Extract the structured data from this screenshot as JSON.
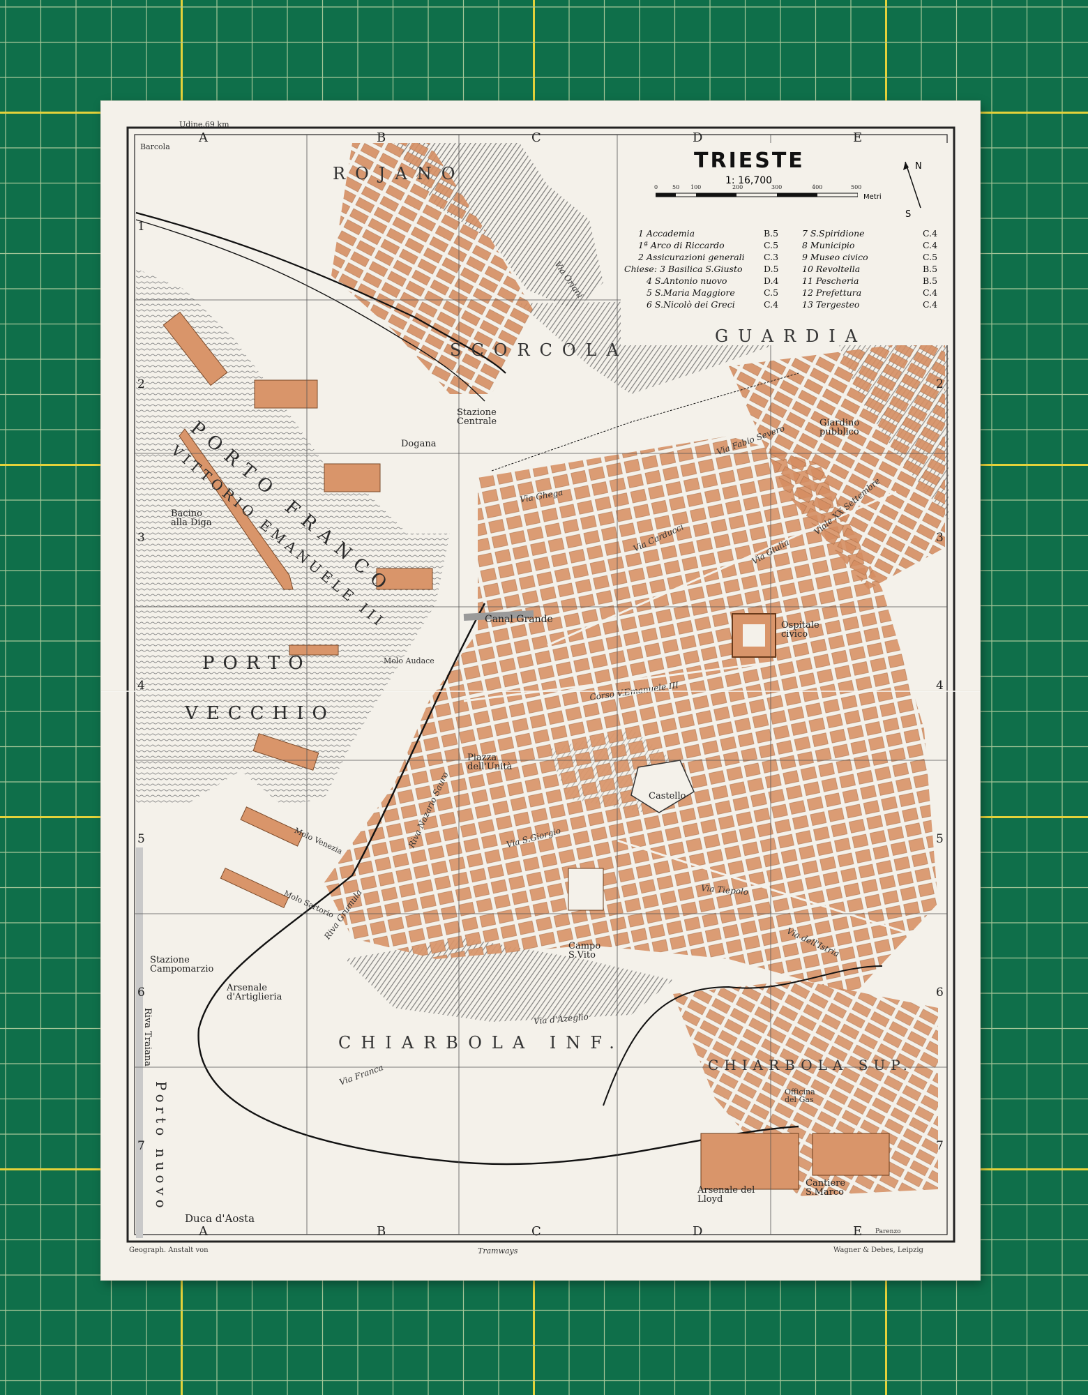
{
  "title": "TRIESTE",
  "scale": "1: 16,700",
  "scale_unit": "Metri",
  "scale_ticks": [
    "0",
    "50",
    "100",
    "200",
    "300",
    "400",
    "500"
  ],
  "compass": {
    "n": "N",
    "s": "S"
  },
  "columns": [
    "A",
    "B",
    "C",
    "D",
    "E"
  ],
  "rows": [
    "1",
    "2",
    "3",
    "4",
    "5",
    "6",
    "7"
  ],
  "legend": [
    {
      "label": "1 Accademia",
      "ref": "B.5"
    },
    {
      "label": "1ª Arco di Riccardo",
      "ref": "C.5"
    },
    {
      "label": "2 Assicurazioni generali",
      "ref": "C.3"
    },
    {
      "label": "Chiese: 3 Basilica S.Giusto",
      "ref": "D.5"
    },
    {
      "label": "4 S.Antonio nuovo",
      "ref": "D.4"
    },
    {
      "label": "5 S.Maria Maggiore",
      "ref": "C.5"
    },
    {
      "label": "6 S.Nicolò dei Greci",
      "ref": "C.4"
    },
    {
      "label": "7 S.Spiridione",
      "ref": "C.4"
    },
    {
      "label": "8 Municipio",
      "ref": "C.4"
    },
    {
      "label": "9 Museo civico",
      "ref": "C.5"
    },
    {
      "label": "10 Revoltella",
      "ref": "B.5"
    },
    {
      "label": "11 Pescheria",
      "ref": "B.5"
    },
    {
      "label": "12 Prefettura",
      "ref": "C.4"
    },
    {
      "label": "13 Tergesteo",
      "ref": "C.4"
    }
  ],
  "districts": [
    "ROJANO",
    "SCORCOLA",
    "GUARDIA",
    "CHIARBOLA INF.",
    "CHIARBOLA SUP."
  ],
  "harbor_labels": [
    "PORTO FRANCO",
    "VITTORIO EMANUELE III",
    "PORTO",
    "VECCHIO",
    "Porto nuovo"
  ],
  "places": {
    "stazione": "Stazione Centrale",
    "dogana": "Dogana",
    "diga": "Bacino alla Diga",
    "canal": "Canal Grande",
    "castello": "Castello",
    "ospitale": "Ospitale civico",
    "giardino": "Giardino pubblico",
    "campo": "Campo S.Vito",
    "arsenale_art": "Arsenale d'Artiglieria",
    "arsenale_lloyd": "Arsenale del Lloyd",
    "cantiere": "Cantiere S.Marco",
    "stazione_camp": "Stazione Campomarzio",
    "duca": "Duca d'Aosta",
    "riva": "Riva Traiana",
    "piazza": "Piazza dell'Unità",
    "molo_sartorio": "Molo Sartorio",
    "molo_venezia": "Molo Venezia",
    "molo_audace": "Molo Audace",
    "gas": "Officina del Gas",
    "udine": "Udine,69 km",
    "barcola": "Barcola",
    "parenzo": "Parenzo"
  },
  "streets": [
    "Via Giulia",
    "Via Carducci",
    "Via Oriani",
    "Via S.Giorgio",
    "Corso V.Emanuele III",
    "Riva Grumula",
    "Via Franca",
    "Via Tiepolo",
    "Via d'Azeglio",
    "Viale XX Settembre",
    "Via Fabio Severo",
    "Via dell'Istria",
    "Via Ghega",
    "Riva Nazario Sauro"
  ],
  "footer": {
    "left": "Geograph. Anstalt von",
    "middle": "Tramways",
    "right": "Wagner & Debes, Leipzig"
  },
  "colors": {
    "mat_green": "#0f6f4a",
    "mat_line": "#e3d23a",
    "paper": "#f4f1ea",
    "buildings": "#d9956a",
    "hills": "#6d6d6d"
  }
}
